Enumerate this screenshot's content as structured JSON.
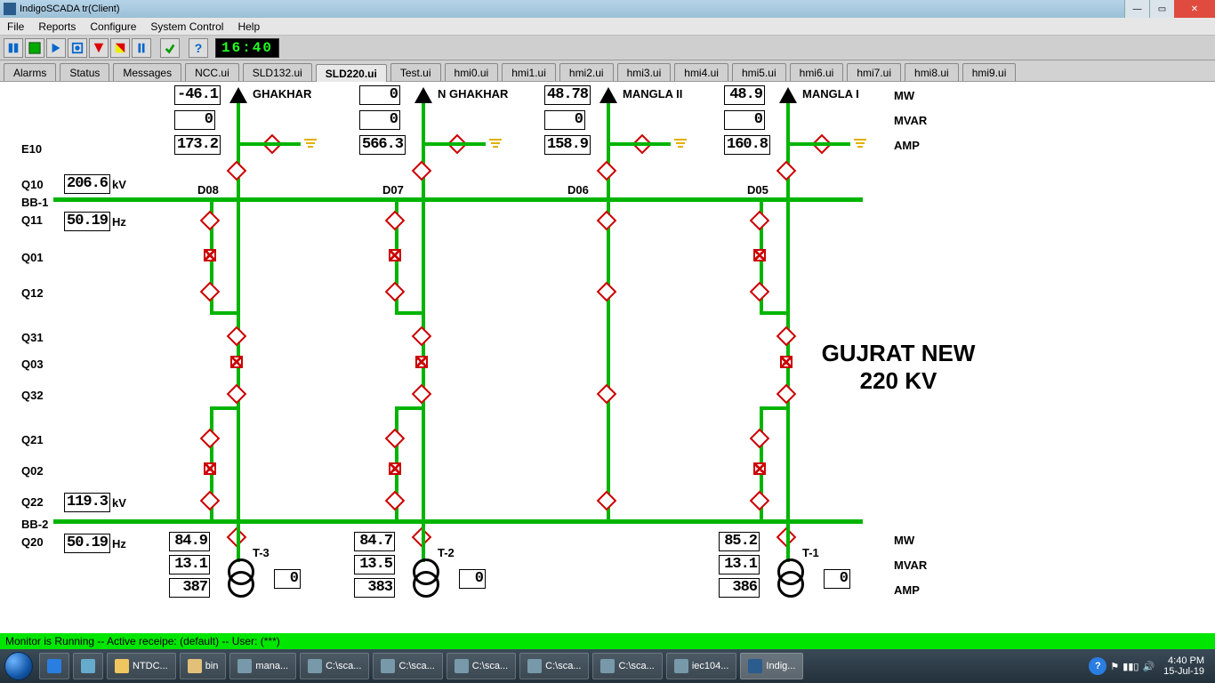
{
  "window": {
    "title": "IndigoSCADA tr(Client)"
  },
  "window_buttons": {
    "min": "—",
    "max": "▭",
    "close": "✕"
  },
  "menu": [
    "File",
    "Reports",
    "Configure",
    "System Control",
    "Help"
  ],
  "toolbar_clock": "16:40",
  "tabs": [
    "Alarms",
    "Status",
    "Messages",
    "NCC.ui",
    "SLD132.ui",
    "SLD220.ui",
    "Test.ui",
    "hmi0.ui",
    "hmi1.ui",
    "hmi2.ui",
    "hmi3.ui",
    "hmi4.ui",
    "hmi5.ui",
    "hmi6.ui",
    "hmi7.ui",
    "hmi8.ui",
    "hmi9.ui"
  ],
  "active_tab": "SLD220.ui",
  "row_labels": [
    "E10",
    "Q10",
    "BB-1",
    "Q11",
    "Q01",
    "Q12",
    "Q31",
    "Q03",
    "Q32",
    "Q21",
    "Q02",
    "Q22",
    "BB-2",
    "Q20"
  ],
  "bus_kv_1": "206.6",
  "bus_kv_1_u": "kV",
  "bus_hz_1": "50.19",
  "bus_hz_1_u": "Hz",
  "bus_kv_2": "119.3",
  "bus_kv_2_u": "kV",
  "bus_hz_2": "50.19",
  "bus_hz_2_u": "Hz",
  "unit_labels": {
    "mw": "MW",
    "mvar": "MVAR",
    "amp": "AMP"
  },
  "feeders_top": [
    {
      "name": "GHAKHAR",
      "did": "D08",
      "mw": "-46.1",
      "mvar": "0",
      "amp": "173.2"
    },
    {
      "name": "N GHAKHAR",
      "did": "D07",
      "mw": "0",
      "mvar": "0",
      "amp": "566.3"
    },
    {
      "name": "MANGLA II",
      "did": "D06",
      "mw": "48.78",
      "mvar": "0",
      "amp": "158.9"
    },
    {
      "name": "MANGLA I",
      "did": "D05",
      "mw": "48.9",
      "mvar": "0",
      "amp": "160.8"
    }
  ],
  "transformers": [
    {
      "name": "T-3",
      "mw": "84.9",
      "mvar": "13.1",
      "amp": "387",
      "small": "0"
    },
    {
      "name": "T-2",
      "mw": "84.7",
      "mvar": "13.5",
      "amp": "383",
      "small": "0"
    },
    {
      "name": "T-1",
      "mw": "85.2",
      "mvar": "13.1",
      "amp": "386",
      "small": "0"
    }
  ],
  "diagram_title_1": "GUJRAT NEW",
  "diagram_title_2": "220 KV",
  "app_status": "Monitor is Running -- Active receipe: (default) -- User: (***)",
  "taskbar": {
    "items": [
      "NTDC...",
      "bin",
      "mana...",
      "C:\\sca...",
      "C:\\sca...",
      "C:\\sca...",
      "C:\\sca...",
      "C:\\sca...",
      "iec104...",
      "Indig..."
    ],
    "time": "4:40 PM",
    "date": "15-Jul-19"
  },
  "tray_icons": {
    "help": "?",
    "flag": "⚑",
    "net": "▮▮▯",
    "vol": "🔊"
  }
}
